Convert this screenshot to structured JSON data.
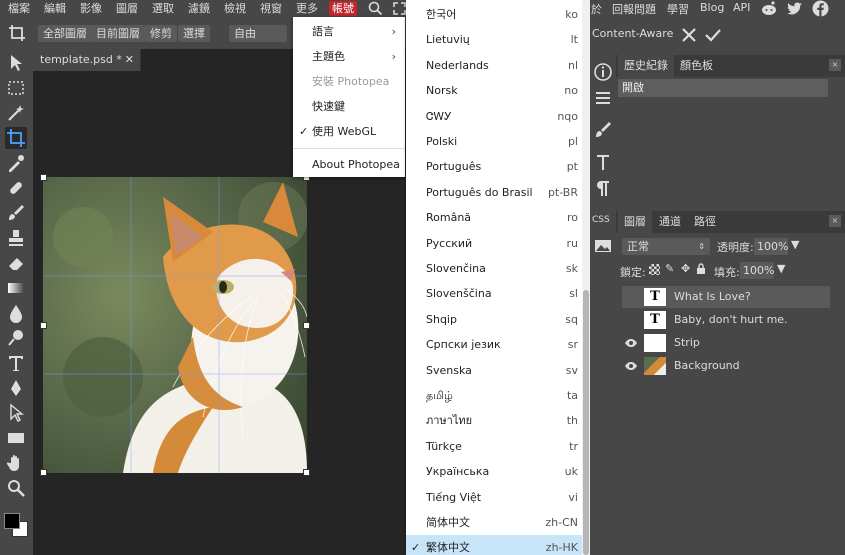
{
  "menubar": {
    "items": [
      "檔案",
      "編輯",
      "影像",
      "圖層",
      "選取",
      "濾鏡",
      "檢視",
      "視窗",
      "更多",
      "帳號"
    ],
    "right_items": [
      "於",
      "回報問題",
      "學習",
      "Blog",
      "API"
    ]
  },
  "toolbar": {
    "buttons": [
      "全部圖層",
      "目前圖層",
      "修剪",
      "選擇"
    ],
    "select_value": "自由",
    "content_aware": "Content-Aware"
  },
  "document": {
    "tab_title": "template.psd *"
  },
  "account_menu": {
    "items": [
      {
        "label": "語言",
        "submenu": true
      },
      {
        "label": "主題色",
        "submenu": true
      },
      {
        "label": "安裝 Photopea",
        "disabled": true
      },
      {
        "label": "快速鍵"
      },
      {
        "label": "使用 WebGL",
        "checked": true
      },
      {
        "label": "About Photopea"
      }
    ]
  },
  "languages": [
    {
      "name": "한국어",
      "code": "ko"
    },
    {
      "name": "Lietuvių",
      "code": "lt"
    },
    {
      "name": "Nederlands",
      "code": "nl"
    },
    {
      "name": "Norsk",
      "code": "no"
    },
    {
      "name": "ᏣᎳᎩ",
      "code": "nqo"
    },
    {
      "name": "Polski",
      "code": "pl"
    },
    {
      "name": "Português",
      "code": "pt"
    },
    {
      "name": "Português do Brasil",
      "code": "pt-BR"
    },
    {
      "name": "Română",
      "code": "ro"
    },
    {
      "name": "Русский",
      "code": "ru"
    },
    {
      "name": "Slovenčina",
      "code": "sk"
    },
    {
      "name": "Slovenščina",
      "code": "sl"
    },
    {
      "name": "Shqip",
      "code": "sq"
    },
    {
      "name": "Српски језик",
      "code": "sr"
    },
    {
      "name": "Svenska",
      "code": "sv"
    },
    {
      "name": "தமிழ்",
      "code": "ta"
    },
    {
      "name": "ภาษาไทย",
      "code": "th"
    },
    {
      "name": "Türkçe",
      "code": "tr"
    },
    {
      "name": "Українська",
      "code": "uk"
    },
    {
      "name": "Tiếng Việt",
      "code": "vi"
    },
    {
      "name": "简体中文",
      "code": "zh-CN"
    },
    {
      "name": "繁体中文",
      "code": "zh-HK",
      "selected": true
    }
  ],
  "history_panel": {
    "tabs": [
      "歷史紀錄",
      "顏色板"
    ],
    "entries": [
      "開啟"
    ]
  },
  "layers_panel": {
    "tabs": [
      "圖層",
      "通道",
      "路徑"
    ],
    "blend_mode": "正常",
    "opacity_label": "透明度:",
    "opacity_value": "100%",
    "lock_label": "鎖定:",
    "fill_label": "填充:",
    "fill_value": "100%",
    "layers": [
      {
        "name": "What Is Love?",
        "type": "text",
        "visible": false,
        "selected": true
      },
      {
        "name": "Baby, don't hurt me.",
        "type": "text",
        "visible": false
      },
      {
        "name": "Strip",
        "type": "raster",
        "visible": true
      },
      {
        "name": "Background",
        "type": "image",
        "visible": true
      }
    ]
  },
  "colors": {
    "accent_red": "#c1272d",
    "selected_lang_bg": "#c8e4f8",
    "ui_bg": "#474747"
  }
}
